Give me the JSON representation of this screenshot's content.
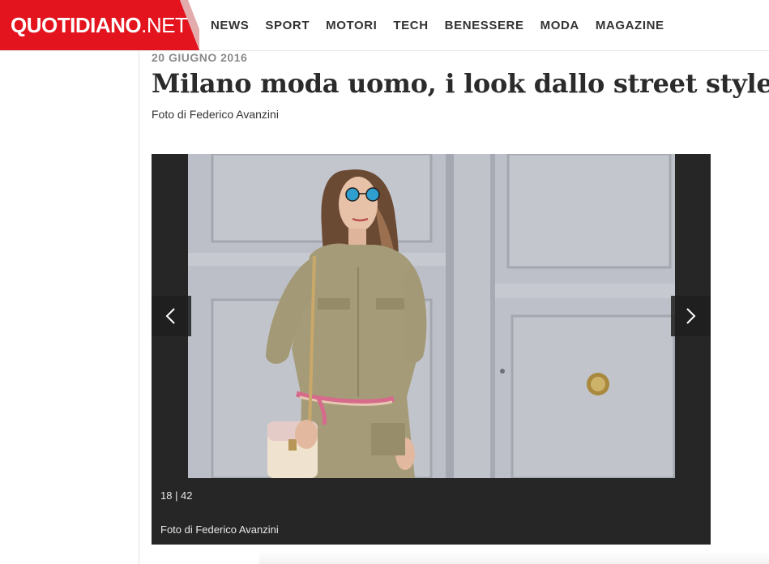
{
  "brand": {
    "logo_bold": "QUOTIDIANO",
    "logo_light": ".NET",
    "logo_color": "#e3141e"
  },
  "nav": {
    "items": [
      {
        "label": "NEWS"
      },
      {
        "label": "SPORT"
      },
      {
        "label": "MOTORI"
      },
      {
        "label": "TECH"
      },
      {
        "label": "BENESSERE"
      },
      {
        "label": "MODA"
      },
      {
        "label": "MAGAZINE"
      }
    ]
  },
  "article": {
    "date": "20 GIUGNO 2016",
    "title": "Milano moda uomo, i look dallo street style",
    "byline": "Foto di Federico Avanzini"
  },
  "gallery": {
    "counter": "18 | 42",
    "caption": "Foto di Federico Avanzini",
    "prev_icon": "chevron-left-icon",
    "next_icon": "chevron-right-icon",
    "background_color": "#262626"
  }
}
